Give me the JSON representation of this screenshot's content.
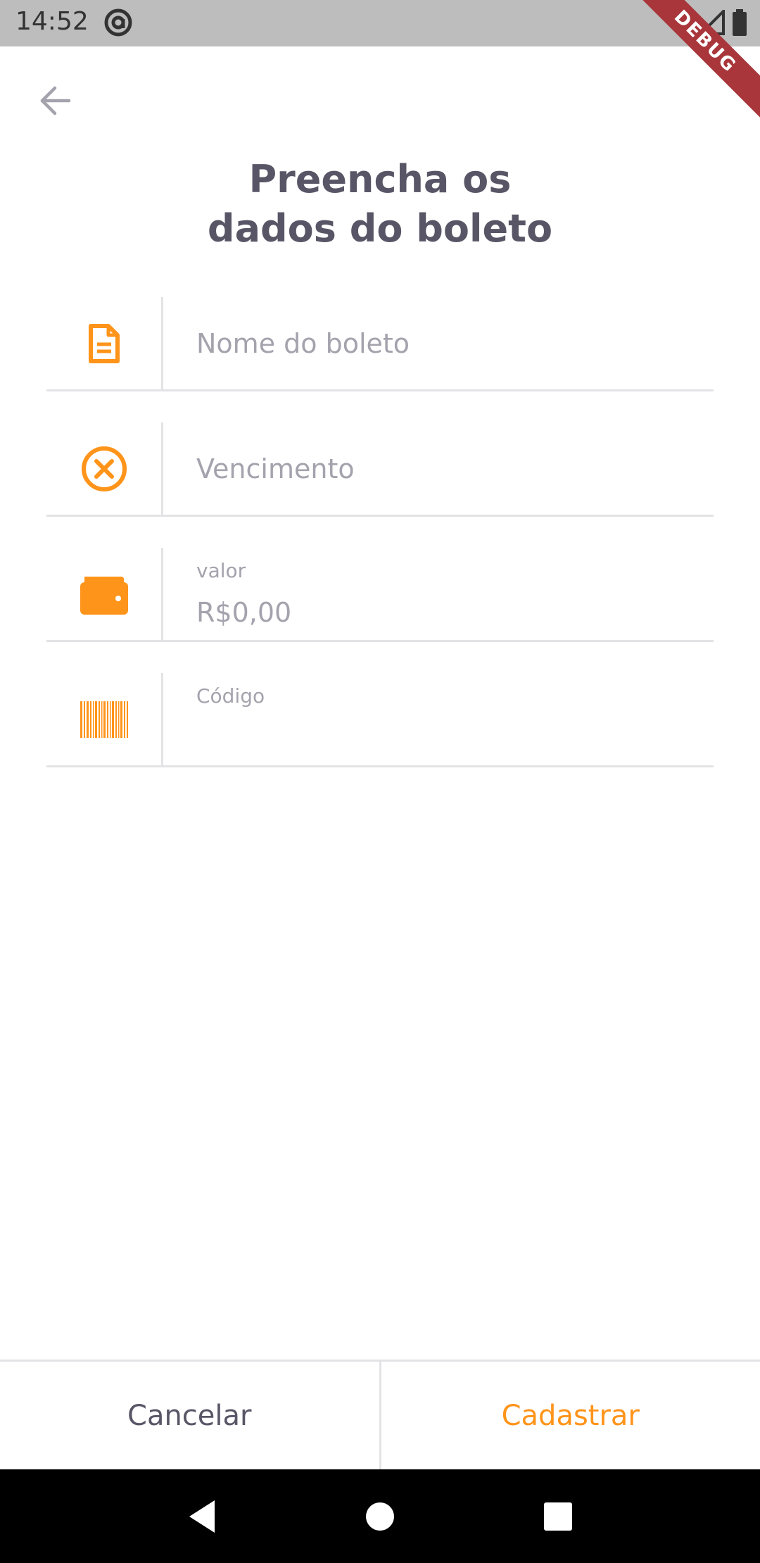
{
  "status_bar": {
    "time": "14:52",
    "debug_label": "DEBUG"
  },
  "header": {
    "title_line1": "Preencha os",
    "title_line2": "dados do boleto"
  },
  "form": {
    "name": {
      "placeholder": "Nome do boleto",
      "icon": "document-icon"
    },
    "due_date": {
      "placeholder": "Vencimento",
      "icon": "cancel-circle-icon"
    },
    "amount": {
      "label": "valor",
      "value": "R$0,00",
      "icon": "wallet-icon"
    },
    "code": {
      "label": "Código",
      "value": "",
      "icon": "barcode-icon"
    }
  },
  "actions": {
    "cancel_label": "Cancelar",
    "submit_label": "Cadastrar"
  },
  "colors": {
    "primary": "#FF941A",
    "heading": "#585666",
    "body": "#A4A3AD",
    "stroke": "#E3E3E6"
  }
}
